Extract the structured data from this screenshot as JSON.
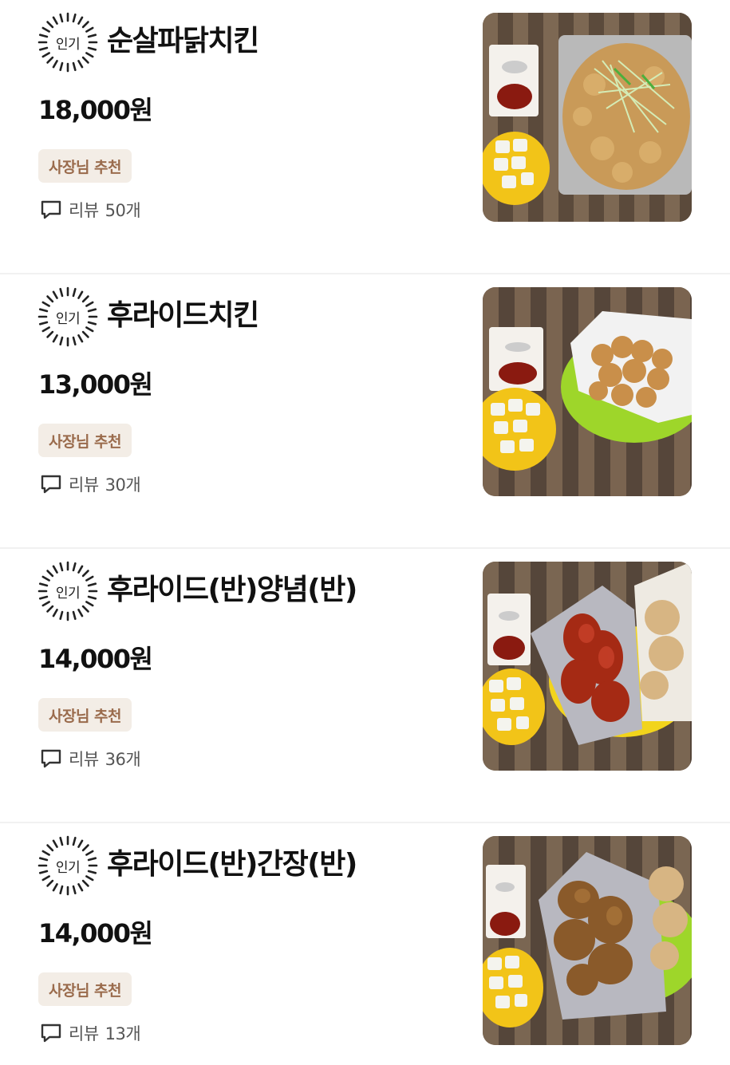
{
  "menu": {
    "items": [
      {
        "badge": "인기",
        "name": "순살파닭치킨",
        "price": "18,000원",
        "tag": "사장님 추천",
        "review_label": "리뷰",
        "review_count": "50개",
        "photo": "boneless-chicken-with-green-onions"
      },
      {
        "badge": "인기",
        "name": "후라이드치킨",
        "price": "13,000원",
        "tag": "사장님 추천",
        "review_label": "리뷰",
        "review_count": "30개",
        "photo": "fried-chicken"
      },
      {
        "badge": "인기",
        "name": "후라이드(반)양념(반)",
        "price": "14,000원",
        "tag": "사장님 추천",
        "review_label": "리뷰",
        "review_count": "36개",
        "photo": "half-fried-half-seasoned-chicken"
      },
      {
        "badge": "인기",
        "name": "후라이드(반)간장(반)",
        "price": "14,000원",
        "tag": "사장님 추천",
        "review_label": "리뷰",
        "review_count": "13개",
        "photo": "half-fried-half-soy-chicken"
      }
    ]
  },
  "colors": {
    "tag_bg": "#f3ede6",
    "tag_text": "#9a6b4c",
    "divider": "#f1f1f1"
  }
}
